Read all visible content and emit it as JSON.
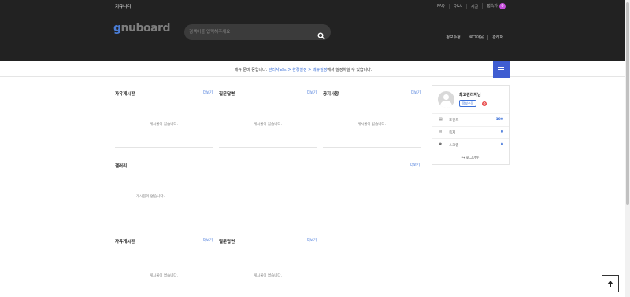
{
  "topbar": {
    "community": "커뮤니티",
    "links": [
      "FAQ",
      "Q&A",
      "새글",
      "접속자"
    ],
    "connect_count": "0"
  },
  "header": {
    "logo_first": "g",
    "logo_rest": "nuboard",
    "search_placeholder": "검색어를 입력해주세요",
    "links": [
      "정보수정",
      "로그아웃",
      "관리자"
    ]
  },
  "notice": {
    "prefix": "메뉴 준비 중입니다. ",
    "link": "관리자모드 > 환경설정 > 메뉴설정",
    "suffix": "에서 설정하실 수 있습니다."
  },
  "boards": [
    {
      "title": "자유게시판",
      "more": "더보기",
      "empty": "게시물이 없습니다."
    },
    {
      "title": "질문답변",
      "more": "더보기",
      "empty": "게시물이 없습니다."
    },
    {
      "title": "공지사항",
      "more": "더보기",
      "empty": "게시물이 없습니다."
    },
    {
      "title": "갤러리",
      "more": "더보기",
      "empty": "게시물이 없습니다."
    },
    {
      "title": "자유게시판",
      "more": "더보기",
      "empty": "게시물이 없습니다."
    },
    {
      "title": "질문답변",
      "more": "더보기",
      "empty": "게시물이 없습니다."
    }
  ],
  "outlogin": {
    "name": "최고관리자님",
    "edit_button": "정보수정",
    "admin_icon": "⚙",
    "rows": [
      {
        "icon": "▤",
        "label": "포인트",
        "value": "100"
      },
      {
        "icon": "✉",
        "label": "쪽지",
        "value": "0"
      },
      {
        "icon": "✱",
        "label": "스크랩",
        "value": "0"
      }
    ],
    "logout": "↪ 로그아웃"
  }
}
